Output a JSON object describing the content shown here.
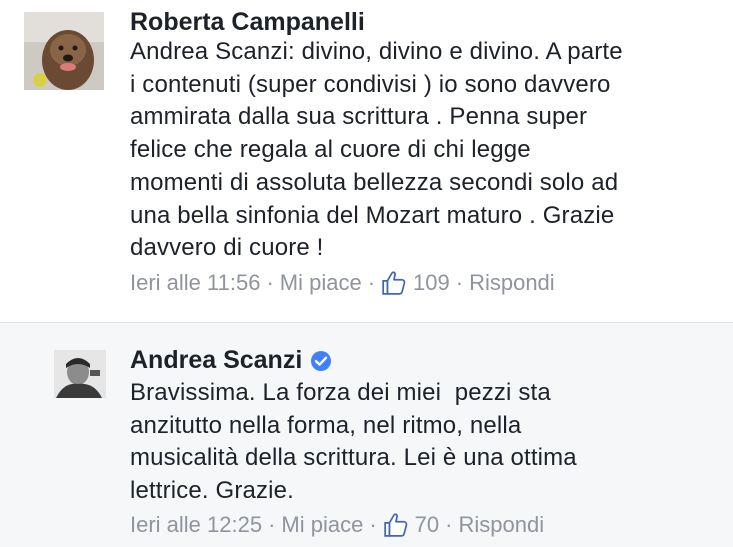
{
  "comments": [
    {
      "author": "Roberta Campanelli",
      "text": "Andrea Scanzi: divino, divino e divino. A parte\ni contenuti (super condivisi ) io sono davvero\nammirata dalla sua scrittura . Penna super\nfelice che regala al cuore di chi legge\nmomenti di assoluta bellezza secondi solo ad\nuna bella sinfonia del Mozart maturo . Grazie\ndavvero di cuore !",
      "time": "Ieri alle 11:56",
      "like_label": "Mi piace",
      "like_count": "109",
      "reply_label": "Rispondi"
    },
    {
      "author": "Andrea Scanzi",
      "verified": true,
      "text": "Bravissima. La forza dei miei  pezzi sta\nanzitutto nella forma, nel ritmo, nella\nmusicalità della scrittura. Lei è una ottima\nlettrice. Grazie.",
      "time": "Ieri alle 12:25",
      "like_label": "Mi piace",
      "like_count": "70",
      "reply_label": "Rispondi"
    }
  ],
  "colors": {
    "meta_text": "#90949c",
    "like_blue": "#4267b2",
    "verified_blue": "#4080ff",
    "reply_bg": "#f6f7f9"
  }
}
